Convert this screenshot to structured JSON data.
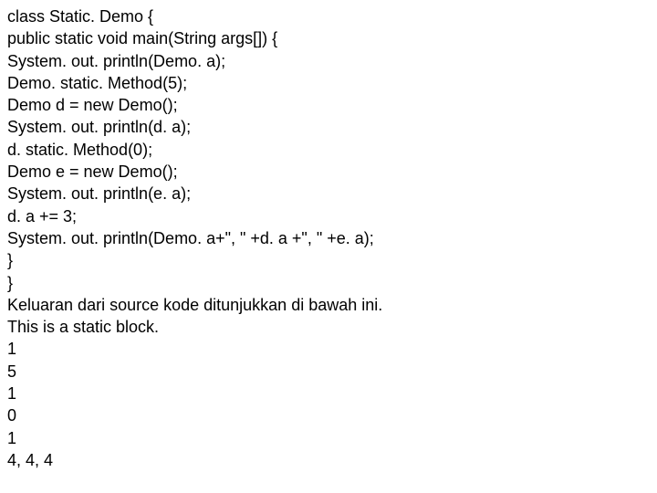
{
  "lines": [
    "class Static. Demo {",
    "public static void main(String args[]) {",
    "System. out. println(Demo. a);",
    "Demo. static. Method(5);",
    "Demo d = new Demo();",
    "System. out. println(d. a);",
    "d. static. Method(0);",
    "Demo e = new Demo();",
    "System. out. println(e. a);",
    "d. a += 3;",
    "System. out. println(Demo. a+\", \" +d. a +\", \" +e. a);",
    "}",
    "}",
    "Keluaran dari source kode ditunjukkan di bawah ini.",
    "This is a static block.",
    "1",
    "5",
    "1",
    "0",
    "1",
    "4, 4, 4"
  ]
}
